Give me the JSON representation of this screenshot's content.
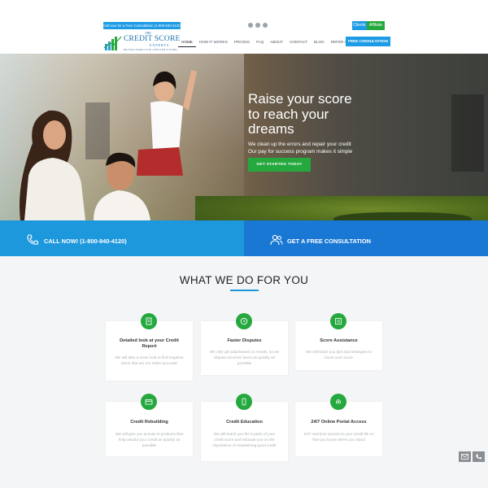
{
  "topbar": {
    "cta_pill": "Call now for a Free Consultation (1-800-940-4120)",
    "social_icons": [
      "facebook-icon",
      "twitter-icon",
      "instagram-icon"
    ],
    "clients_label": "Clients",
    "affiliate_label": "Affiliate"
  },
  "header": {
    "logo_the": "THE",
    "logo_name": "CREDIT SCORE",
    "logo_experts": "EXPERTS",
    "logo_tagline": "BETTER CREDIT FOR A BETTER FUTURE",
    "nav": [
      "HOME",
      "HOW IT WORKS",
      "PRICING",
      "FAQ",
      "ABOUT",
      "CONTACT",
      "BLOG",
      "REFER A FRIEND"
    ],
    "consult_button": "FREE CONSULTATION"
  },
  "hero": {
    "title_line1": "Raise your score",
    "title_line2": "to reach your",
    "title_line3": "dreams",
    "sub_line1": "We clean up the errors and repair your credit",
    "sub_line2": "Our pay for success program makes it simple",
    "button": "GET STARTED TODAY"
  },
  "cta": {
    "call": "CALL NOW! (1-800-940-4120)",
    "consult": "GET A FREE CONSULTATION"
  },
  "section": {
    "title": "WHAT WE DO FOR YOU",
    "cards": [
      {
        "title": "Detailed look at your Credit Report",
        "desc": "We will take a close look to find negative items that are not 100% accurate",
        "icon": "report-icon"
      },
      {
        "title": "Faster Disputes",
        "desc": "We only get paid based on results, so we dispute incorrect items as quickly as possible",
        "icon": "clock-icon"
      },
      {
        "title": "Score Assistance",
        "desc": "We will teach you tips and strategies to boost your score",
        "icon": "chart-list-icon"
      },
      {
        "title": "Credit Rebuilding",
        "desc": "We will give you access to products that help rebuild your credit as quickly as possible",
        "icon": "credit-card-icon"
      },
      {
        "title": "Credit Education",
        "desc": "We will teach you the 5 parts of your credit score and educate you on the importance of maintaining good credit",
        "icon": "mobile-icon"
      },
      {
        "title": "24/7 Online Portal Access",
        "desc": "24/7 real time access to your credit file so that you know where you stand",
        "icon": "fingerprint-icon"
      }
    ]
  },
  "colors": {
    "blue": "#1e98dd",
    "dark_blue": "#1978d4",
    "green": "#25a83e"
  }
}
